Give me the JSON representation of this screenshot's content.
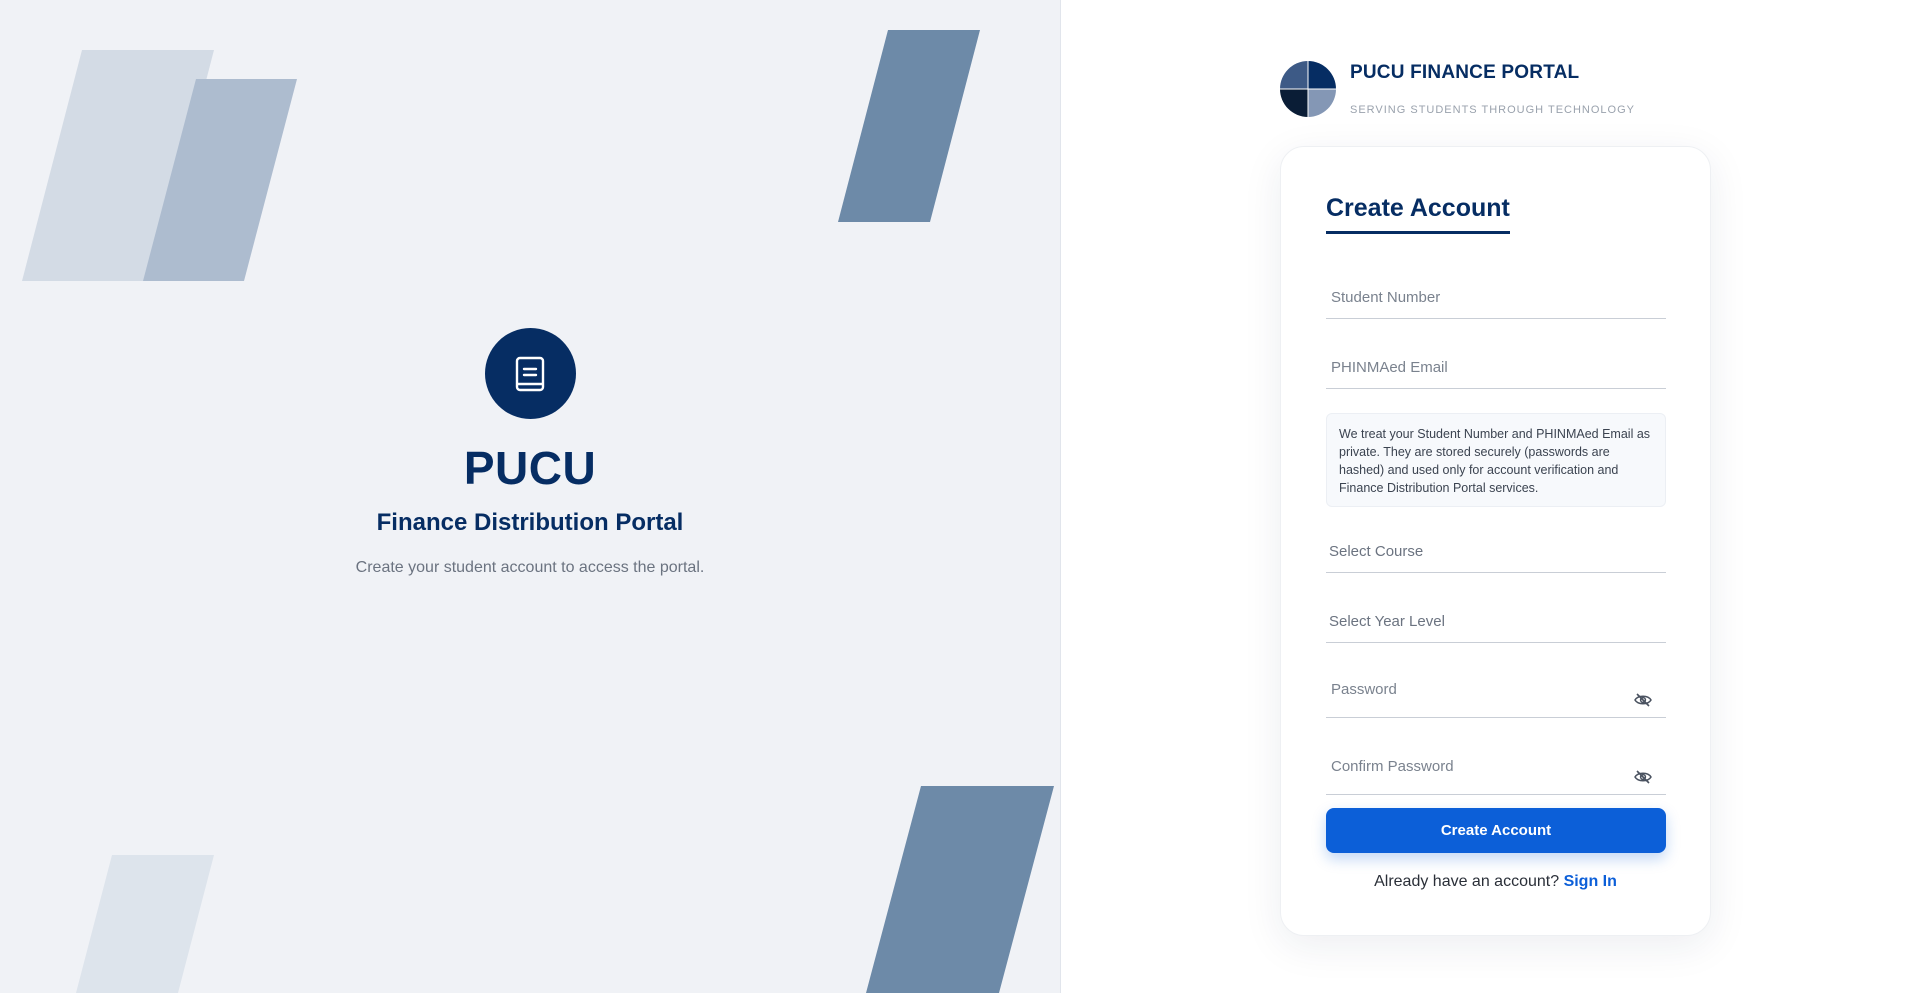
{
  "hero": {
    "title": "PUCU",
    "subtitle": "Finance Distribution Portal",
    "description": "Create your student account to access the portal.",
    "icon": "book-icon"
  },
  "brand": {
    "name": "PUCU FINANCE PORTAL",
    "tagline": "SERVING STUDENTS THROUGH TECHNOLOGY"
  },
  "form": {
    "title": "Create Account",
    "student_number_placeholder": "Student Number",
    "email_placeholder": "PHINMAed Email",
    "privacy_notice": "We treat your Student Number and PHINMAed Email as private. They are stored securely (passwords are hashed) and used only for account verification and Finance Distribution Portal services.",
    "course_placeholder": "Select Course",
    "year_level_placeholder": "Select Year Level",
    "password_placeholder": "Password",
    "confirm_password_placeholder": "Confirm Password",
    "submit_label": "Create Account",
    "have_account_text": "Already have an account?",
    "sign_in_label": "Sign In"
  },
  "colors": {
    "navy": "#062d63",
    "primary_button": "#0c5fd8",
    "left_background": "#f0f2f6",
    "shape_dark": "#6d8aa8",
    "shape_mid": "#adbccf",
    "shape_light": "#d3dbe5"
  }
}
